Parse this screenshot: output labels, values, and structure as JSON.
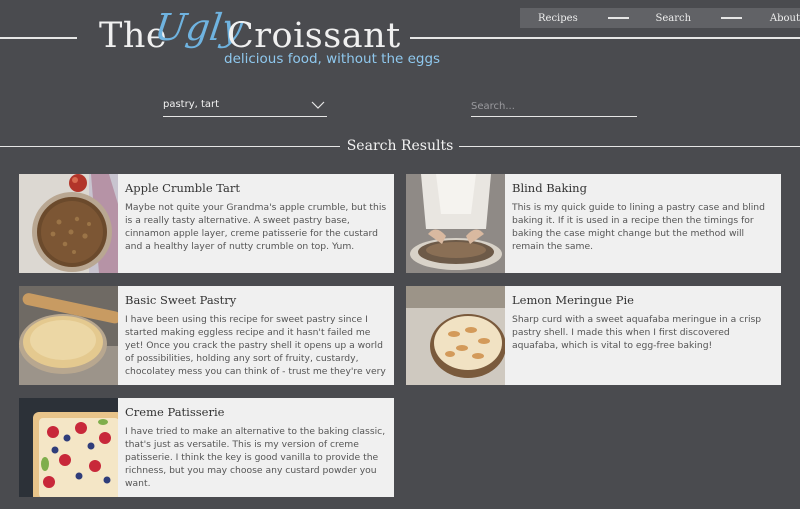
{
  "header": {
    "logo_the": "The",
    "logo_ugly": "Ugly",
    "logo_croissant": "Croissant",
    "tagline": "delicious food, without the eggs"
  },
  "nav": {
    "items": [
      {
        "label": "Recipes"
      },
      {
        "label": "Search"
      },
      {
        "label": "About"
      }
    ]
  },
  "filters": {
    "tag_value": "pastry, tart",
    "search_placeholder": "Search..."
  },
  "results": {
    "title": "Search Results",
    "cards": [
      {
        "title": "Apple Crumble Tart",
        "description": "Maybe not quite your Grandma's apple crumble, but this is a really tasty alternative. A sweet pastry base, cinnamon apple layer, creme patisserie for the custard and a healthy layer of nutty crumble on top. Yum."
      },
      {
        "title": "Blind Baking",
        "description": "This is my quick guide to lining a pastry case and blind baking it. If it is used in a recipe then the timings for baking the case might change but the method will remain the same."
      },
      {
        "title": "Basic Sweet Pastry",
        "description": "I have been using this recipe for sweet pastry since I started making eggless recipe and it hasn't failed me yet! Once you crack the pastry shell it opens up a world of possibilities, holding any sort of fruity, custardy, chocolatey mess you can think of - trust me they're very"
      },
      {
        "title": "Lemon Meringue Pie",
        "description": "Sharp curd with a sweet aquafaba meringue in a crisp pastry shell. I made this when I first discovered aquafaba, which is vital to egg-free baking!"
      },
      {
        "title": "Creme Patisserie",
        "description": "I have tried to make an alternative to the baking classic, that's just as versatile. This is my version of creme patisserie. I think the key is good vanilla to provide the richness, but you may choose any custard powder you want."
      }
    ]
  },
  "colors": {
    "background": "#4a4b4f",
    "accent": "#6fb3e0",
    "card": "#f0f0f0"
  }
}
